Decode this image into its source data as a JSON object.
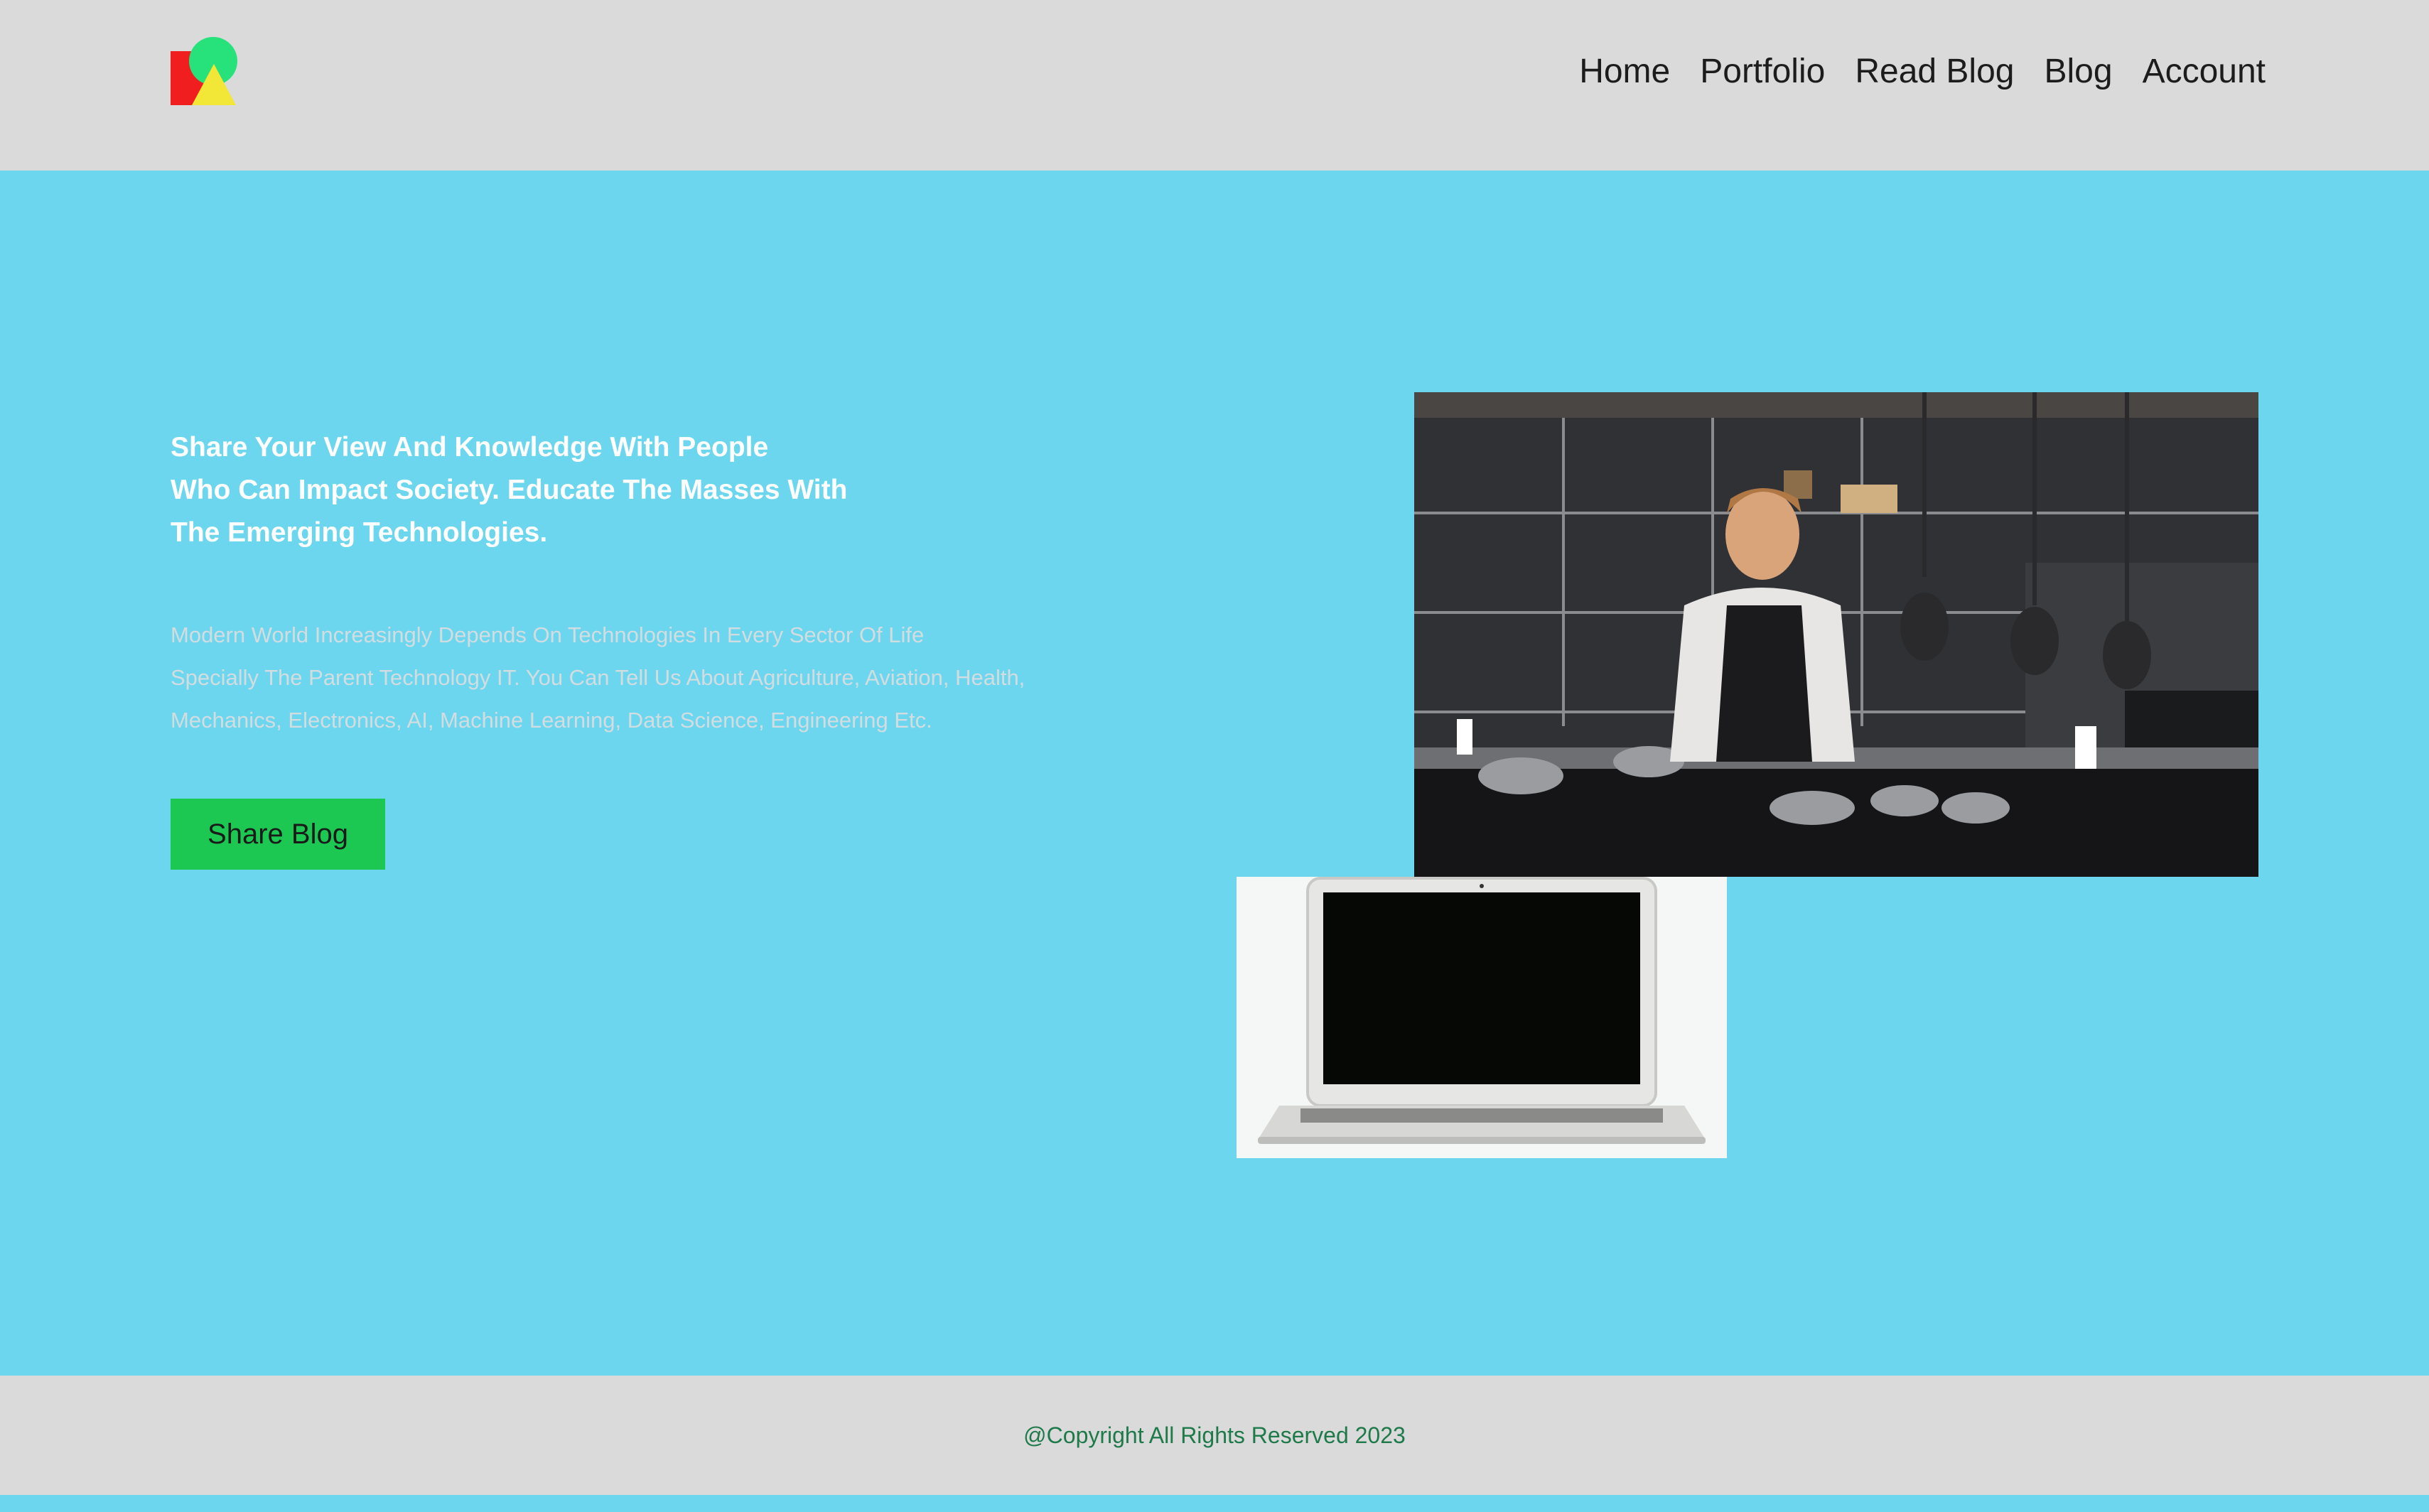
{
  "nav": {
    "items": [
      "Home",
      "Portfolio",
      "Read Blog",
      "Blog",
      "Account"
    ]
  },
  "hero": {
    "headline_lines": [
      "Share Your View And Knowledge With People",
      "Who Can Impact Society. Educate The Masses With",
      "The Emerging Technologies."
    ],
    "description_lines": [
      "Modern World Increasingly Depends On Technologies In Every Sector Of Life",
      "Specially The Parent Technology IT. You Can Tell Us About Agriculture, Aviation, Health,",
      "Mechanics, Electronics, AI, Machine Learning, Data Science, Engineering Etc."
    ],
    "button_label": "Share Blog"
  },
  "footer": {
    "copyright": "@Copyright All Rights Reserved 2023"
  },
  "colors": {
    "header_bg": "#dadada",
    "hero_bg": "#6cd6ef",
    "button_bg": "#1cc752",
    "footer_text": "#1f7a4a",
    "logo_red": "#f01e1e",
    "logo_green": "#27e27a",
    "logo_yellow": "#f2e637"
  }
}
